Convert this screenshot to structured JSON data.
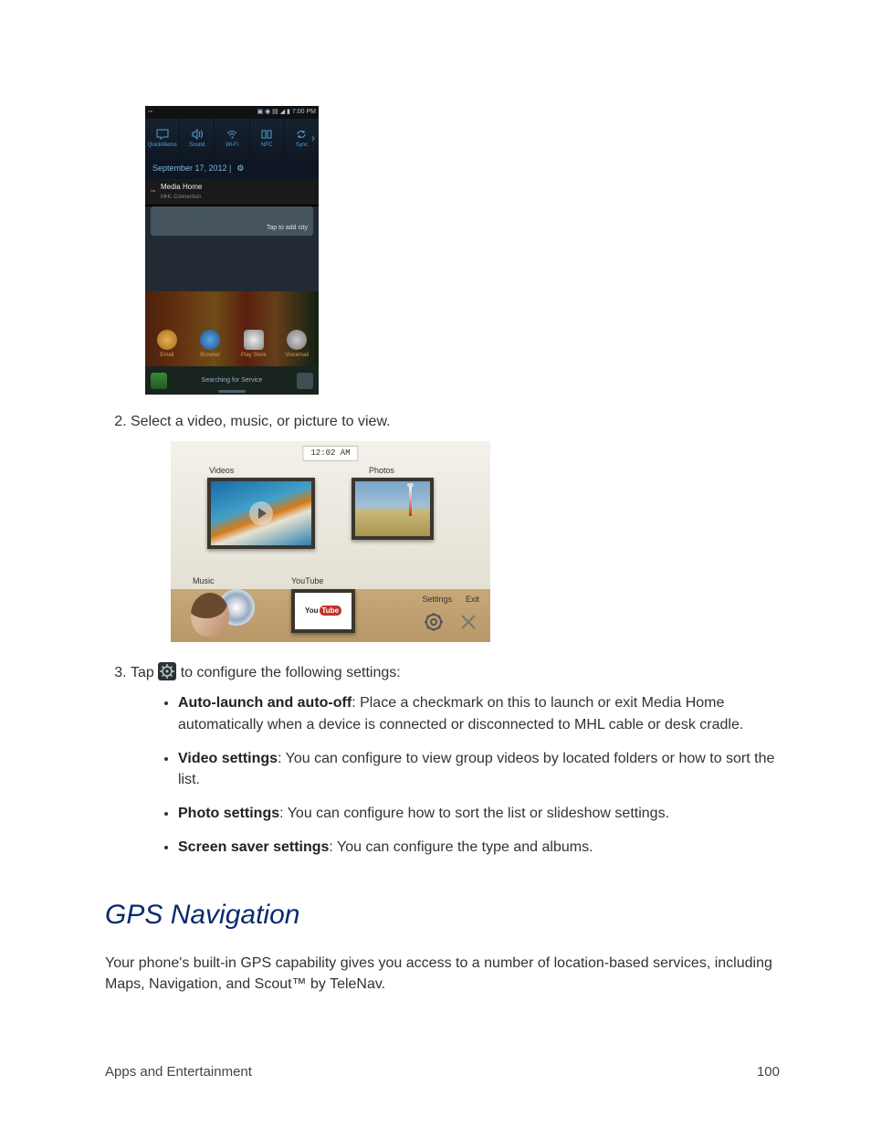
{
  "steps": {
    "s2_text": "Select a video, music, or picture to view.",
    "s3_prefix": "Tap ",
    "s3_suffix": " to configure the following settings:"
  },
  "bullets": {
    "b1_bold": "Auto-launch and auto-off",
    "b1_text": ": Place a checkmark on this to launch or exit Media Home automatically when a device is connected or disconnected to MHL cable or desk cradle.",
    "b2_bold": "Video settings",
    "b2_text": ": You can configure to view group videos by located folders or how to sort the list.",
    "b3_bold": "Photo settings",
    "b3_text": ": You can configure how to sort the list or slideshow settings.",
    "b4_bold": "Screen saver settings",
    "b4_text": ": You can configure the type and albums."
  },
  "heading": "GPS Navigation",
  "intro": "Your phone's built-in GPS capability gives you access to a number of location-based services, including Maps, Navigation, and Scout™ by TeleNav.",
  "footer": {
    "left": "Apps and Entertainment",
    "right": "100"
  },
  "shot1": {
    "time": "7:00 PM",
    "toggles": [
      "QuickMemo",
      "Sound",
      "Wi-Fi",
      "NFC",
      "Sync"
    ],
    "date_line": "September 17, 2012  |",
    "notif_title": "Media Home",
    "notif_sub": "MHL Connection",
    "weather_label": "",
    "weather_add": "Tap to add city",
    "apps": [
      "Email",
      "Browser",
      "Play Store",
      "Voicemail"
    ],
    "searching": "Searching for Service"
  },
  "shot2": {
    "clock": "12:02 AM",
    "videos": "Videos",
    "photos": "Photos",
    "music": "Music",
    "youtube": "YouTube",
    "yt_you": "You",
    "yt_tube": "Tube",
    "settings": "Settings",
    "exit": "Exit"
  }
}
